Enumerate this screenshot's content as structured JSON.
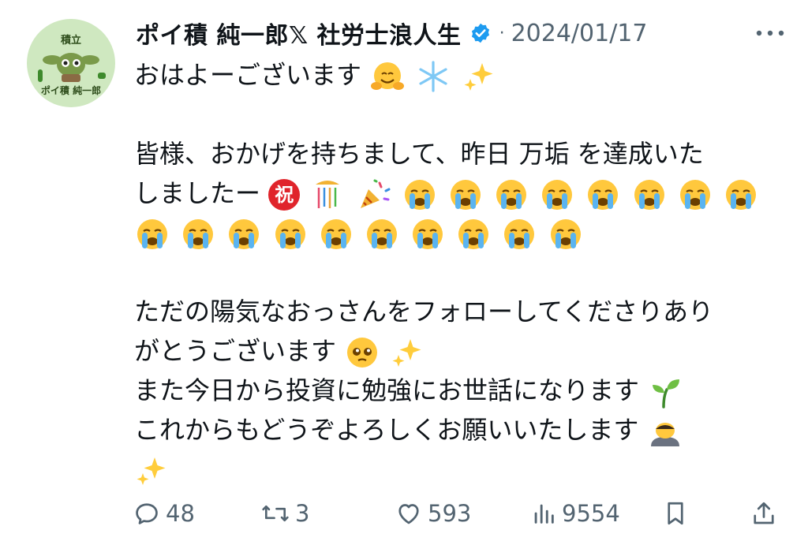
{
  "author": {
    "display_name": "ポイ積 純一郎𝕏 社労士浪人生",
    "avatar_text_top": "積立",
    "avatar_text_bottom": "ポイ積 純一郎",
    "separator": "·",
    "date": "2024/01/17"
  },
  "tweet": {
    "lines": [
      "おはよーございます",
      "皆様、おかげを持ちまして、昨日 万垢 を達成いた",
      "しましたー",
      "ただの陽気なおっさんをフォローしてくださりあり",
      "がとうございます",
      "また今日から投資に勉強にお世話になります",
      "これからもどうぞよろしくお願いいたします"
    ],
    "iwai_char": "祝"
  },
  "actions": {
    "replies": "48",
    "retweets": "3",
    "likes": "593",
    "views": "9554"
  },
  "colors": {
    "text": "#0f1419",
    "muted": "#536471",
    "verified": "#1d9bf0",
    "avatar_bg": "#cfe8c0"
  },
  "icons": [
    "verified-badge-icon",
    "more-icon",
    "reply-icon",
    "retweet-icon",
    "like-icon",
    "views-icon",
    "bookmark-icon",
    "share-icon",
    "hug-emoji",
    "snowflake-emoji",
    "sparkles-emoji",
    "iwai-emoji",
    "kusudama-emoji",
    "party-popper-emoji",
    "crying-emoji",
    "pleading-emoji",
    "seedling-emoji",
    "bowing-emoji"
  ]
}
